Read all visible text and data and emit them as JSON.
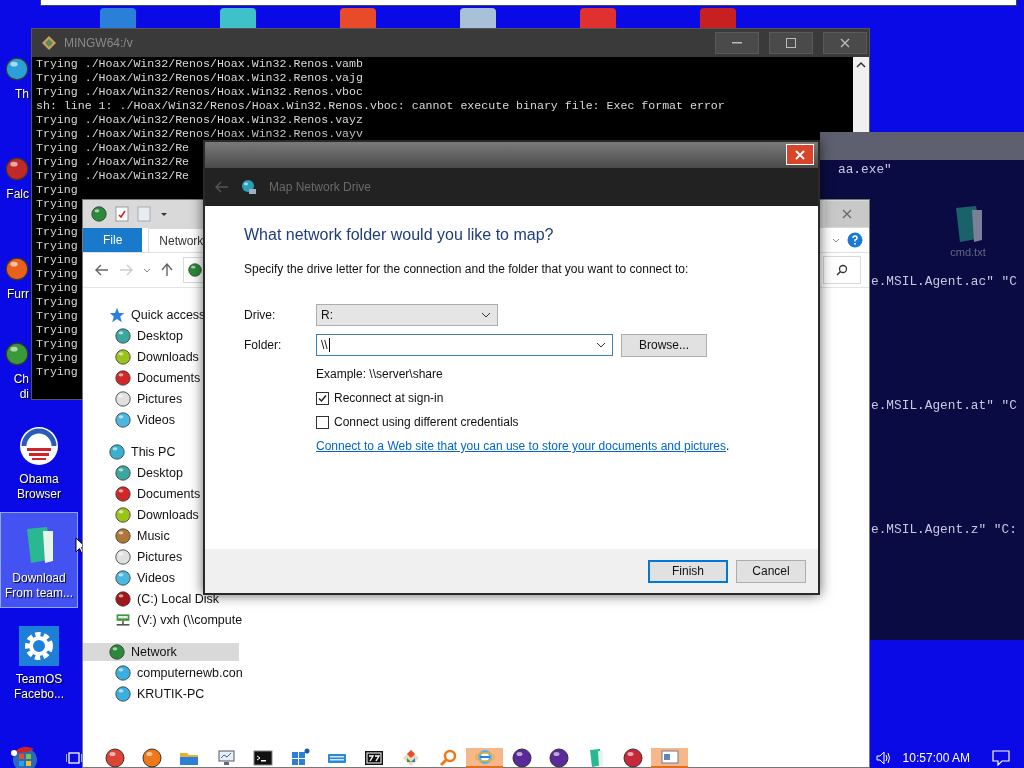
{
  "desktop_icons": [
    {
      "kind": "sphere",
      "color": "#2a9fd8",
      "lines": [
        "Th"
      ],
      "selected": false
    },
    {
      "kind": "sphere",
      "color": "#c0282a",
      "lines": [
        "Falc"
      ],
      "selected": false
    },
    {
      "kind": "sphere",
      "color": "#e8601c",
      "lines": [
        "Furr"
      ],
      "selected": false
    },
    {
      "kind": "sphere",
      "color": "#3a9a3a",
      "lines": [
        "Ch",
        "di"
      ],
      "selected": false
    },
    {
      "kind": "stripes",
      "lines": [
        "Obama",
        "Browser"
      ],
      "selected": false
    },
    {
      "kind": "notepad",
      "lines": [
        "Download",
        "From team..."
      ],
      "selected": true
    },
    {
      "kind": "gear",
      "lines": [
        "TeamOS",
        "Facebo..."
      ],
      "selected": false
    }
  ],
  "terminal": {
    "title": "MINGW64:/v",
    "lines": [
      "Trying ./Hoax/Win32/Renos/Hoax.Win32.Renos.vamb",
      "Trying ./Hoax/Win32/Renos/Hoax.Win32.Renos.vajg",
      "Trying ./Hoax/Win32/Renos/Hoax.Win32.Renos.vboc",
      "sh: line 1: ./Hoax/Win32/Renos/Hoax.Win32.Renos.vboc: cannot execute binary file: Exec format error",
      "Trying ./Hoax/Win32/Renos/Hoax.Win32.Renos.vayz",
      "Trying ./Hoax/Win32/Renos/Hoax.Win32.Renos.vayv",
      "Trying ./Hoax/Win32/Re",
      "Trying ./Hoax/Win32/Re",
      "Trying ./Hoax/Win32/Re",
      "Trying",
      "Trying",
      "Trying",
      "Trying",
      "Trying",
      "Trying",
      "Trying",
      "Trying",
      "Trying",
      "Trying",
      "Trying",
      "Trying",
      "Trying",
      "Trying"
    ]
  },
  "console": {
    "lines": [
      "aa.exe\"",
      "e.MSIL.Agent.ac\" \"C",
      "e.MSIL.Agent.at\" \"C",
      "e.MSIL.Agent.z\" \"C:"
    ],
    "desktop_file": "cmd.txt"
  },
  "explorer": {
    "tabs": [
      {
        "label": "File",
        "kind": "menu",
        "selected": false
      },
      {
        "label": "Network",
        "kind": "tab",
        "selected": true
      }
    ],
    "sidebar": [
      {
        "label": "Quick access",
        "kind": "star",
        "color": "#2a7fd8",
        "selected": false,
        "children": [
          {
            "label": "Desktop",
            "kind": "sphere",
            "color": "#3aa8a0",
            "selected": false
          },
          {
            "label": "Downloads",
            "kind": "sphere",
            "color": "#9cc21c",
            "selected": false
          },
          {
            "label": "Documents",
            "kind": "sphere",
            "color": "#d0282a",
            "selected": false
          },
          {
            "label": "Pictures",
            "kind": "sphere",
            "color": "#e0e0e0",
            "selected": false
          },
          {
            "label": "Videos",
            "kind": "sphere",
            "color": "#4ab8e0",
            "selected": false
          }
        ]
      },
      {
        "label": "This PC",
        "kind": "sphere",
        "color": "#3ab0d0",
        "selected": false,
        "children": [
          {
            "label": "Desktop",
            "kind": "sphere",
            "color": "#3aa8a0",
            "selected": false
          },
          {
            "label": "Documents",
            "kind": "sphere",
            "color": "#d0282a",
            "selected": false
          },
          {
            "label": "Downloads",
            "kind": "sphere",
            "color": "#9cc21c",
            "selected": false
          },
          {
            "label": "Music",
            "kind": "sphere",
            "color": "#b07838",
            "selected": false
          },
          {
            "label": "Pictures",
            "kind": "sphere",
            "color": "#e0e0e0",
            "selected": false
          },
          {
            "label": "Videos",
            "kind": "sphere",
            "color": "#4ab8e0",
            "selected": false
          },
          {
            "label": "(C:) Local Disk",
            "kind": "sphere",
            "color": "#a01818",
            "selected": false
          },
          {
            "label": "(V:) vxh (\\\\compute",
            "kind": "drive",
            "color": "#3a9a3a",
            "selected": false
          }
        ]
      },
      {
        "label": "Network",
        "kind": "sphere",
        "color": "#2a8a3a",
        "selected": true,
        "children": [
          {
            "label": "computernewb.con",
            "kind": "sphere",
            "color": "#3ab0e0",
            "selected": false
          },
          {
            "label": "KRUTIK-PC",
            "kind": "sphere",
            "color": "#3ab0e0",
            "selected": false
          }
        ]
      }
    ]
  },
  "dialog": {
    "title": "Map Network Drive",
    "heading": "What network folder would you like to map?",
    "instruction": "Specify the drive letter for the connection and the folder that you want to connect to:",
    "drive": {
      "label": "Drive:",
      "value": "R:"
    },
    "folder": {
      "label": "Folder:",
      "value": "\\\\",
      "button": "Browse..."
    },
    "example": "Example: \\\\server\\share",
    "options": [
      {
        "label": "Reconnect at sign-in",
        "checked": true
      },
      {
        "label": "Connect using different credentials",
        "checked": false
      }
    ],
    "link": "Connect to a Web site that you can use to store your documents and pictures",
    "link_tail": ".",
    "buttons": [
      {
        "label": "Finish",
        "kind": "default"
      },
      {
        "label": "Cancel",
        "kind": "normal"
      }
    ]
  },
  "taskbar": {
    "apps": [
      {
        "kind": "sphere",
        "color": "#db4437",
        "selected": false
      },
      {
        "kind": "sphere",
        "color": "#f07818",
        "selected": false
      },
      {
        "kind": "folder",
        "selected": false
      },
      {
        "kind": "monitor",
        "selected": false
      },
      {
        "kind": "console",
        "selected": false
      },
      {
        "kind": "tiles",
        "selected": false
      },
      {
        "kind": "keyboard",
        "selected": false
      },
      {
        "kind": "zip",
        "selected": false
      },
      {
        "kind": "diamond",
        "selected": false
      },
      {
        "kind": "magnifier",
        "selected": false
      },
      {
        "kind": "ring",
        "selected": true
      },
      {
        "kind": "sphere",
        "color": "#5a2a9a",
        "selected": false
      },
      {
        "kind": "sphere",
        "color": "#5a2a9a",
        "selected": false
      },
      {
        "kind": "notepad",
        "selected": false
      },
      {
        "kind": "sphere",
        "color": "#c8283a",
        "selected": false
      },
      {
        "kind": "window",
        "selected": true
      }
    ],
    "clock": "10:57:00 AM"
  }
}
